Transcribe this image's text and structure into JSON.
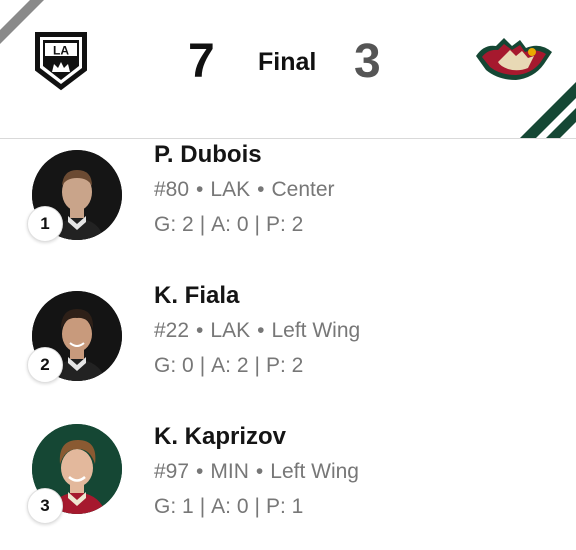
{
  "game": {
    "home_score": "7",
    "status": "Final",
    "away_score": "3",
    "home_logo_icon": "la-kings-logo-icon",
    "away_logo_icon": "minnesota-wild-logo-icon",
    "home_logo_text": "LA",
    "colors": {
      "wild_green": "#154734",
      "kings_black": "#111111",
      "wild_red": "#a6192e"
    }
  },
  "players": [
    {
      "rank": "1",
      "name": "P. Dubois",
      "number": "#80",
      "team": "LAK",
      "position": "Center",
      "goals": "G: 2",
      "assists": "A: 0",
      "points": "P: 2"
    },
    {
      "rank": "2",
      "name": "K. Fiala",
      "number": "#22",
      "team": "LAK",
      "position": "Left Wing",
      "goals": "G: 0",
      "assists": "A: 2",
      "points": "P: 2"
    },
    {
      "rank": "3",
      "name": "K. Kaprizov",
      "number": "#97",
      "team": "MIN",
      "position": "Left Wing",
      "goals": "G: 1",
      "assists": "A: 0",
      "points": "P: 1"
    }
  ]
}
